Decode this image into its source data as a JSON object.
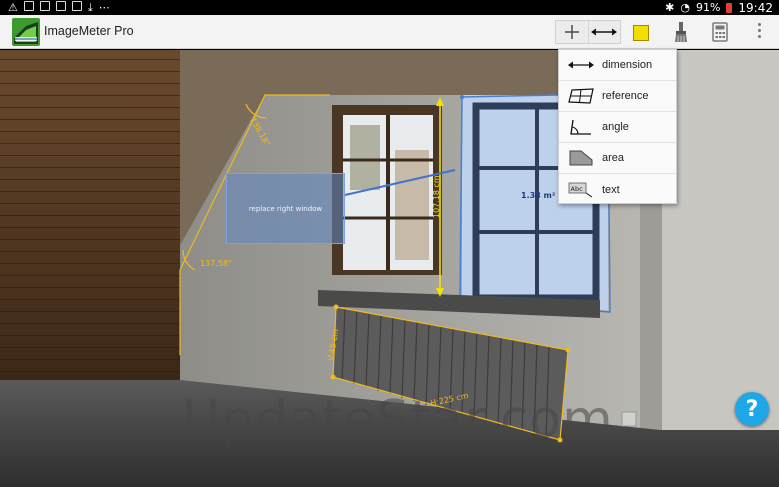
{
  "status_bar": {
    "battery": "91%",
    "time": "19:42"
  },
  "app": {
    "title": "ImageMeter Pro"
  },
  "toolbar": {
    "add_tool_icon": "plus-icon",
    "dimension_tool_icon": "double-arrow-icon",
    "color_swatch": "#f2df00",
    "brush_icon": "brush-icon",
    "calculator_icon": "calculator-icon",
    "overflow_icon": "overflow-menu-icon"
  },
  "dropdown_menu": {
    "items": [
      {
        "label": "dimension",
        "icon": "dimension-icon"
      },
      {
        "label": "reference",
        "icon": "reference-icon"
      },
      {
        "label": "angle",
        "icon": "angle-icon"
      },
      {
        "label": "area",
        "icon": "area-icon"
      },
      {
        "label": "text",
        "icon": "text-icon"
      }
    ]
  },
  "annotations": {
    "angle_top": "138.18°",
    "angle_left": "137.58°",
    "window_height": "107.18 cm",
    "window_area": "1.38 m²",
    "radiator_height": "V:45 cm",
    "radiator_width": "H:225 cm",
    "callout_text": "replace right window"
  },
  "watermark": "UpdateStar.com",
  "help": {
    "label": "?"
  },
  "colors": {
    "measure_line": "#f1b820",
    "dimension_line": "#f2e000",
    "reference_fill": "#4a7fd0"
  }
}
